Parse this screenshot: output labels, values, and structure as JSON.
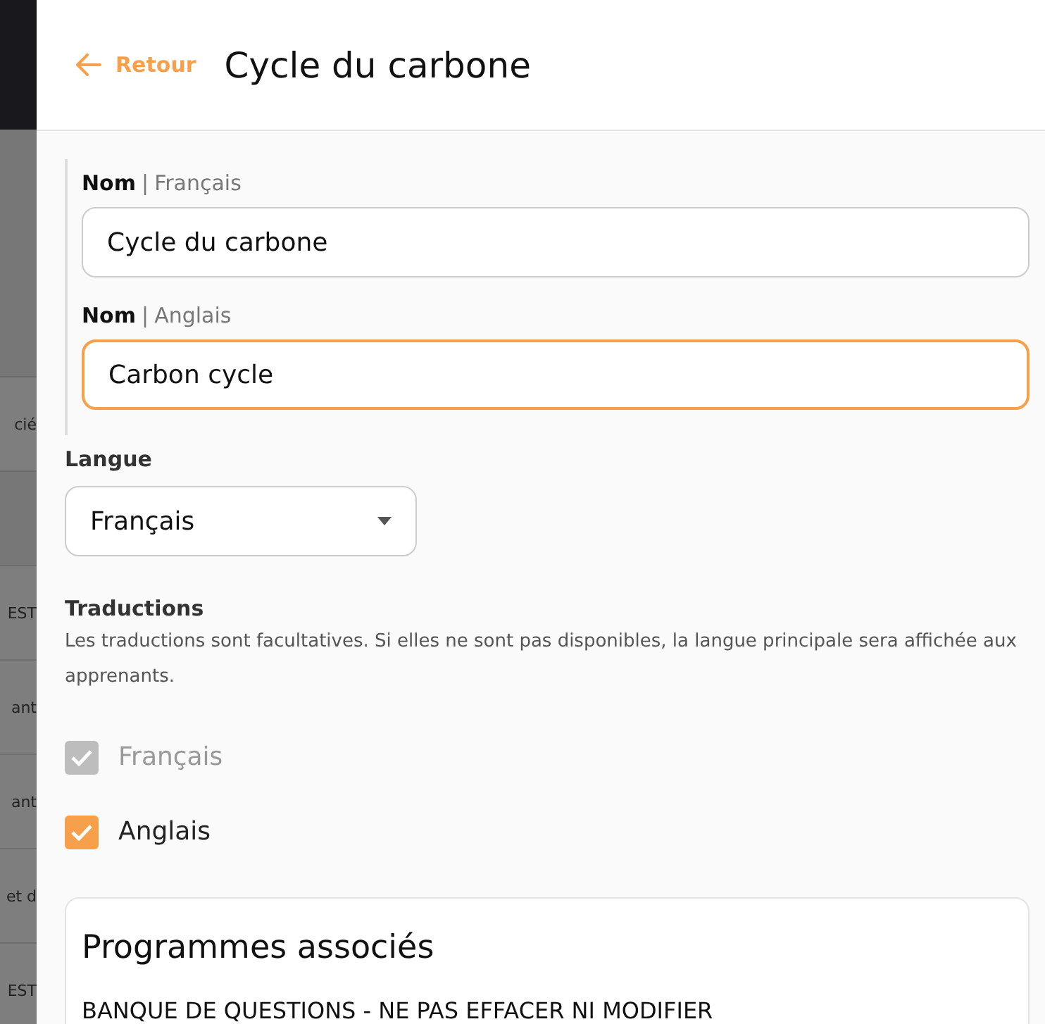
{
  "background_list": {
    "items": [
      "cié",
      "EST",
      "ant",
      "ant",
      "et d",
      "EST"
    ]
  },
  "header": {
    "back_label": "Retour",
    "title": "Cycle du carbone"
  },
  "name_fields": [
    {
      "label": "Nom",
      "separator": "|",
      "language": "Français",
      "value": "Cycle du carbone",
      "focused": false
    },
    {
      "label": "Nom",
      "separator": "|",
      "language": "Anglais",
      "value": "Carbon cycle",
      "focused": true
    }
  ],
  "language": {
    "label": "Langue",
    "value": "Français"
  },
  "translations": {
    "title": "Traductions",
    "description": "Les traductions sont facultatives. Si elles ne sont pas disponibles, la langue principale sera affichée aux apprenants.",
    "options": [
      {
        "label": "Français",
        "checked": true,
        "disabled": true
      },
      {
        "label": "Anglais",
        "checked": true,
        "disabled": false
      }
    ]
  },
  "programs": {
    "title": "Programmes associés",
    "items": [
      "BANQUE DE QUESTIONS - NE PAS EFFACER NI MODIFIER"
    ]
  }
}
